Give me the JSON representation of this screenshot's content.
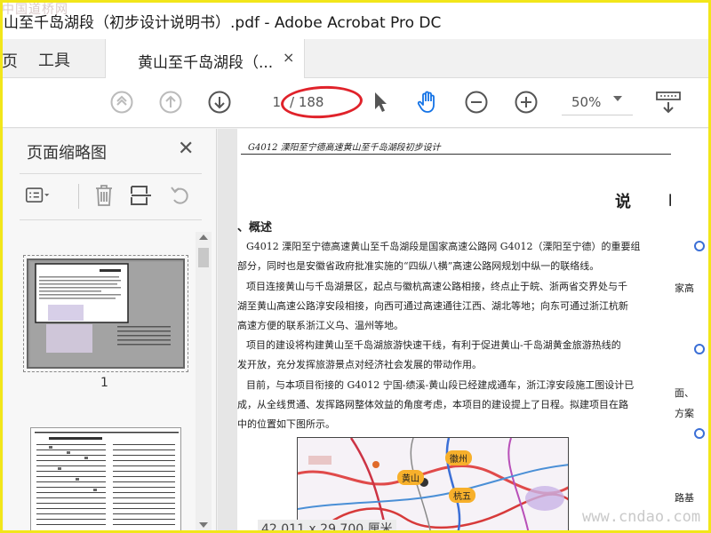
{
  "window": {
    "title": "山至千岛湖段（初步设计说明书）.pdf - Adobe Acrobat Pro DC",
    "watermark_top": "中国道桥网",
    "watermark_bottom": "www.cndao.com"
  },
  "tabs": {
    "cut_label": "页",
    "tools_label": "工具",
    "document_label": "黄山至千岛湖段（...",
    "close_glyph": "×"
  },
  "toolbar": {
    "current_page": "1",
    "total_pages": "/ 188",
    "zoom": "50%",
    "icons": [
      "first-page-icon",
      "previous-page-icon",
      "next-page-icon",
      "select-cursor-icon",
      "hand-tool-icon",
      "zoom-out-icon",
      "zoom-in-icon",
      "zoom-dropdown",
      "keyboard-icon"
    ],
    "hand_tool_color": "#1473e6"
  },
  "left_panel": {
    "title": "页面缩略图",
    "close_glyph": "✕",
    "thumbnail_1_number": "1"
  },
  "document": {
    "header": "G4012 溧阳至宁德高速黄山至千岛湖段初步设计",
    "title": "说 明 书",
    "section_heading": "、概述",
    "paragraphs": [
      "G4012 溧阳至宁德高速黄山至千岛湖段是国家高速公路网 G4012（溧阳至宁德）的重要组",
      "部分，同时也是安徽省政府批准实施的“四纵八横”高速公路网规划中纵一的联络线。",
      "项目连接黄山与千岛湖景区，起点与徽杭高速公路相接，终点止于皖、浙两省交界处与千",
      "湖至黄山高速公路淳安段相接，向西可通过高速通往江西、湖北等地；向东可通过浙江杭新",
      "高速方便的联系浙江义乌、温州等地。",
      "项目的建设将构建黄山至千岛湖旅游快速干线，有利于促进黄山-千岛湖黄金旅游热线的",
      "发开放，充分发挥旅游景点对经济社会发展的带动作用。",
      "目前，与本项目衔接的 G4012 宁国-绩溪-黄山段已经建成通车，浙江淳安段施工图设计已",
      "成，从全线贯通、发挥路网整体效益的角度考虑，本项目的建设提上了日程。拟建项目在路",
      "中的位置如下图所示。"
    ],
    "map_labels": [
      "徽州",
      "黄山",
      "杭五"
    ],
    "right_page_fragments": [
      "家高",
      "面、",
      "方案",
      "路基"
    ]
  },
  "status": {
    "page_size": "42.011 x 29.700 厘米"
  }
}
